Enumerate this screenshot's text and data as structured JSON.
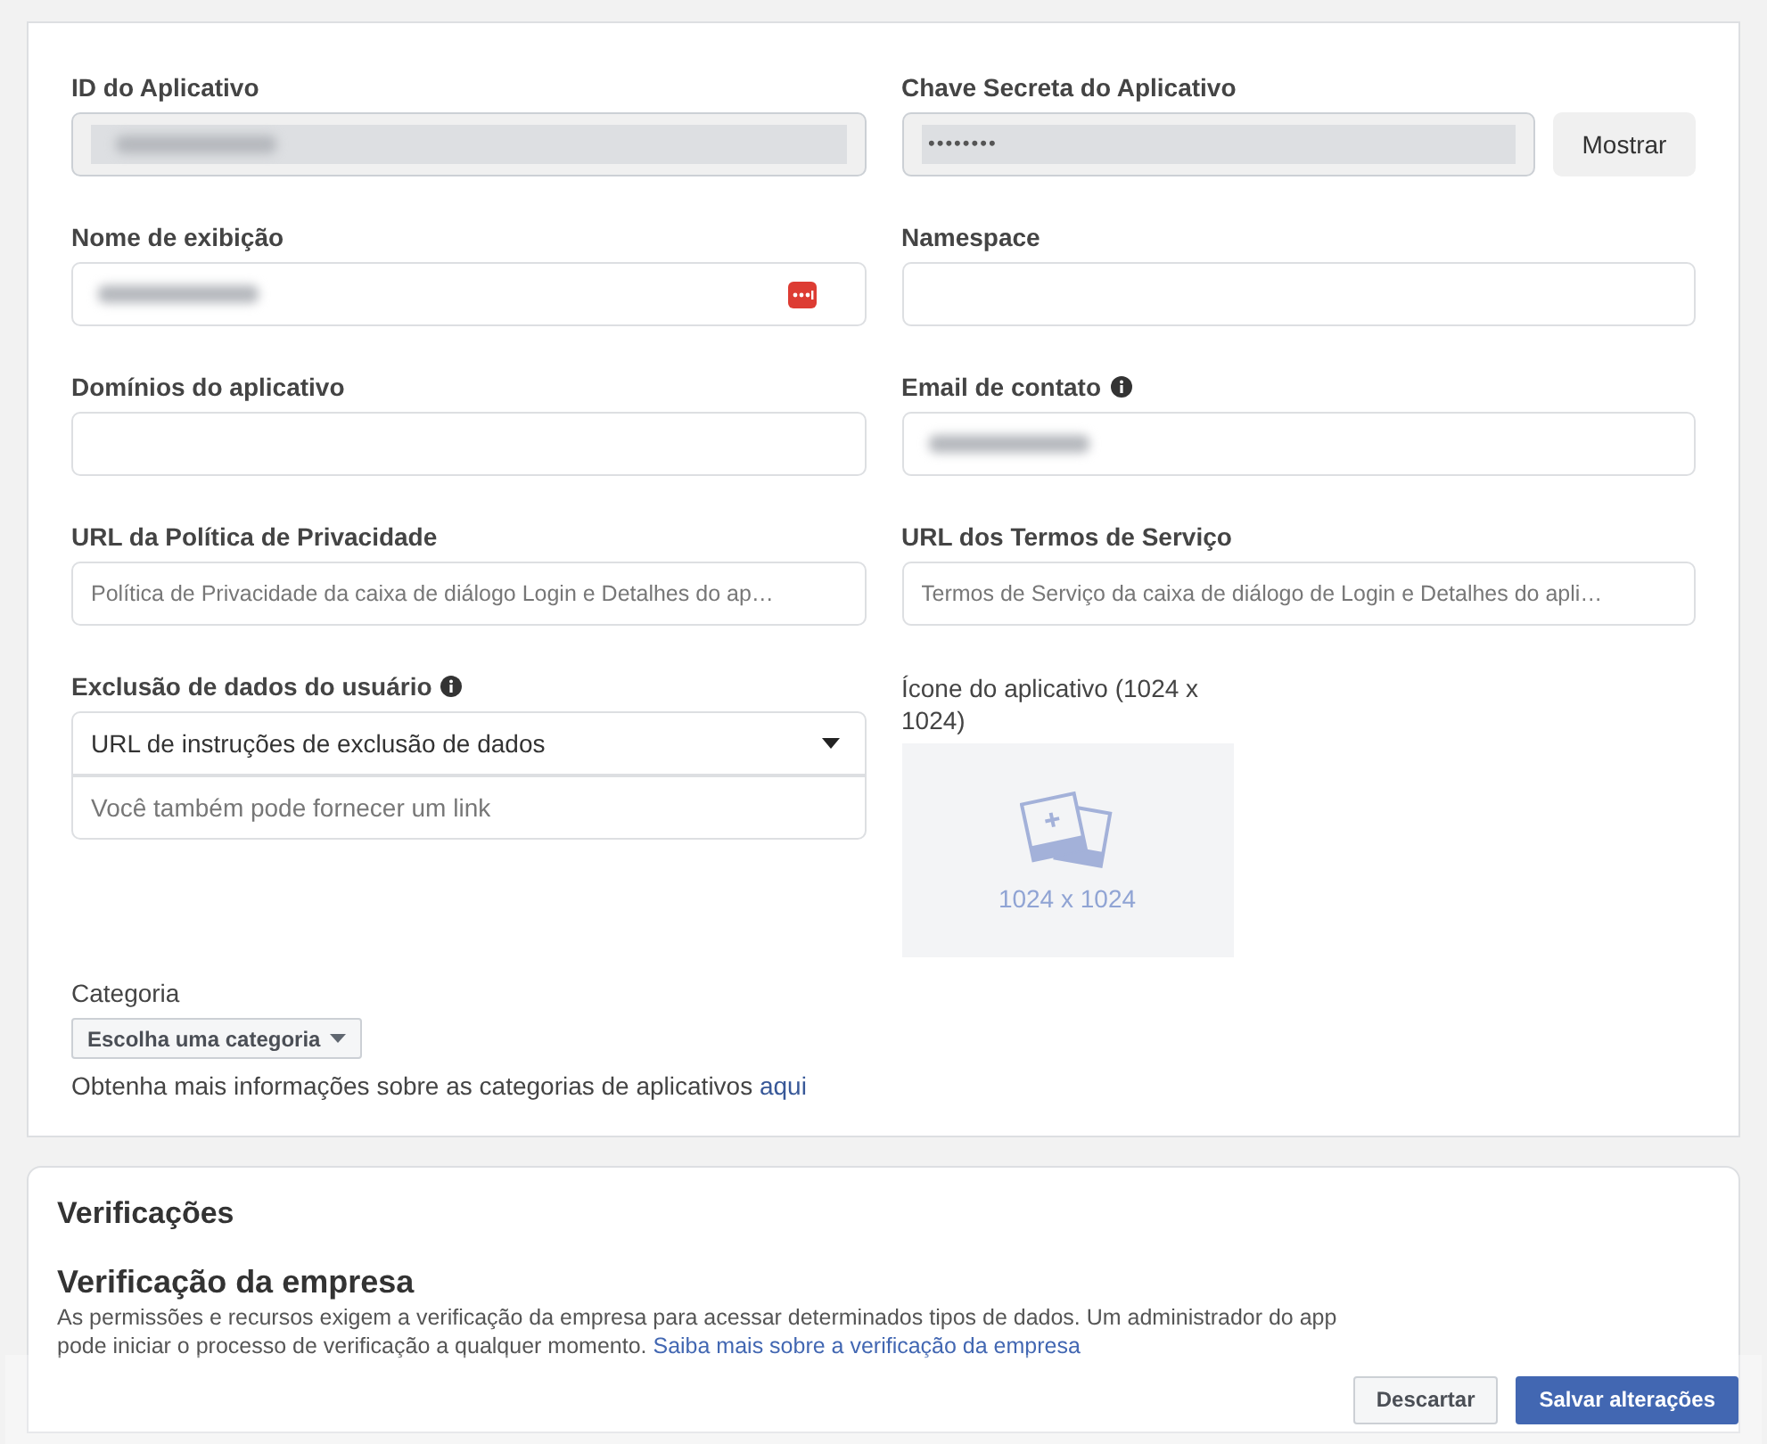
{
  "app_settings": {
    "fields": [
      {
        "label": "ID do Aplicativo",
        "kind": "readonly",
        "info": false,
        "redacted": true
      },
      {
        "label": "Chave Secreta do Aplicativo",
        "kind": "secret",
        "info": false,
        "value": "••••••••",
        "button": "Mostrar"
      },
      {
        "label": "Nome de exibição",
        "kind": "text",
        "info": false,
        "redacted": true,
        "autofill_icon": true
      },
      {
        "label": "Namespace",
        "kind": "text",
        "info": false,
        "redacted": false
      },
      {
        "label": "Domínios do aplicativo",
        "kind": "text",
        "info": false,
        "redacted": false
      },
      {
        "label": "Email de contato",
        "kind": "text",
        "info": true,
        "redacted": true
      },
      {
        "label": "URL da Política de Privacidade",
        "kind": "text",
        "info": false,
        "redacted": false,
        "placeholder": "Política de Privacidade da caixa de diálogo Login e Detalhes do ap…"
      },
      {
        "label": "URL dos Termos de Serviço",
        "kind": "text",
        "info": false,
        "redacted": false,
        "placeholder": "Termos de Serviço da caixa de diálogo de Login e Detalhes do apli…"
      },
      {
        "label": "Exclusão de dados do usuário",
        "kind": "select",
        "info": true,
        "value": "URL de instruções de exclusão de dados",
        "link_placeholder": "Você também pode fornecer um link"
      },
      {
        "label": "Ícone do aplicativo (1024 x 1024)",
        "kind": "image",
        "info": false,
        "caption": "1024 x 1024"
      }
    ],
    "category": {
      "label": "Categoria",
      "button": "Escolha uma categoria",
      "help": "Obtenha mais informações sobre as categorias de aplicativos",
      "help_link": "aqui"
    }
  },
  "verifications": {
    "title": "Verificações",
    "subtitle": "Verificação da empresa",
    "text": "As permissões e recursos exigem a verificação da empresa para acessar determinados tipos de dados. Um administrador do app pode iniciar o processo de verificação a qualquer momento.",
    "link": "Saiba mais sobre a verificação da empresa"
  },
  "footer": {
    "buttons": [
      {
        "label": "Descartar",
        "kind": "secondary"
      },
      {
        "label": "Salvar alterações",
        "kind": "primary"
      }
    ]
  }
}
